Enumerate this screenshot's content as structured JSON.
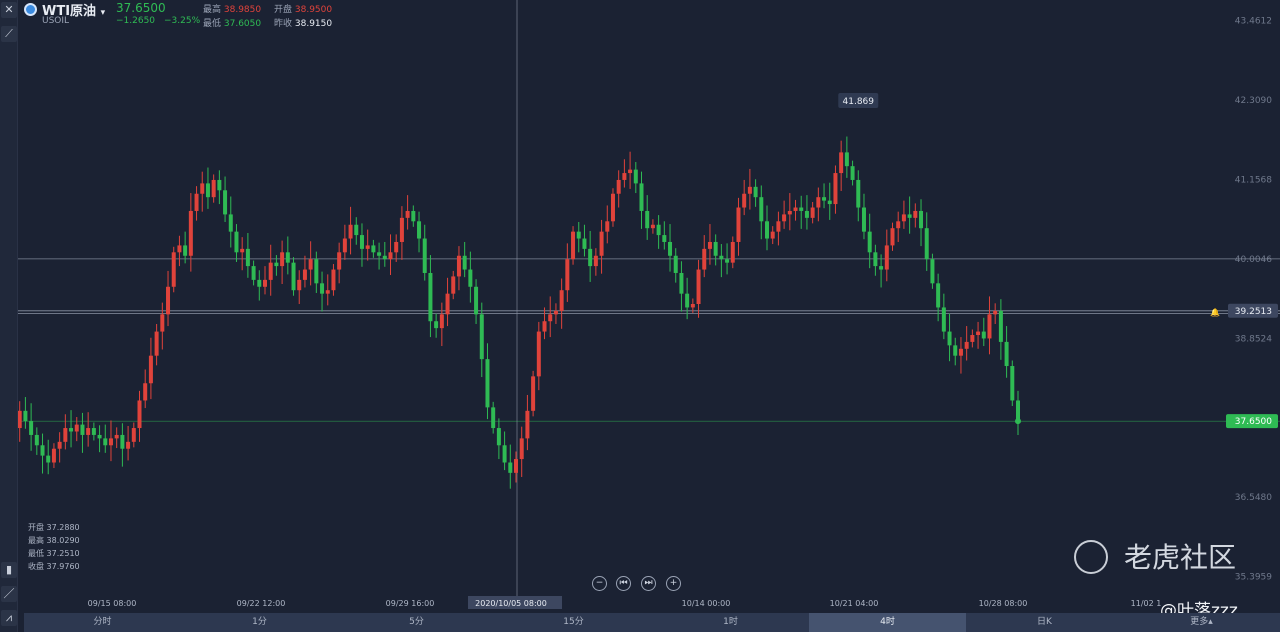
{
  "header": {
    "symbol_name": "WTI原油",
    "symbol_code": "USOIL",
    "last_price": "37.6500",
    "change": "−1.2650",
    "change_pct": "−3.25%",
    "high_label": "最高",
    "high_value": "38.9850",
    "low_label": "最低",
    "low_value": "37.6050",
    "open_label": "开盘",
    "open_value": "38.9500",
    "prev_label": "昨收",
    "prev_value": "38.9150"
  },
  "crosshair_ohlc": {
    "open": "开盘 37.2880",
    "high": "最高 38.0290",
    "low": "最低 37.2510",
    "close": "收盘 37.9760"
  },
  "chart_data": {
    "type": "candlestick",
    "y_ticks": [
      "43.4612",
      "42.3090",
      "41.1568",
      "40.0046",
      "38.8524",
      "36.5480",
      "35.3959"
    ],
    "ylim": [
      35.2,
      43.5
    ],
    "x_tick_labels": [
      "09/15 08:00",
      "09/22 12:00",
      "09/29 16:00",
      "2020/10/05 08:00",
      "10/14 00:00",
      "10/21 04:00",
      "10/28 08:00",
      "11/02 1"
    ],
    "crosshair_x_label": "2020/10/05 08:00",
    "price_label_right": "39.2513",
    "last_price_label": "37.6500",
    "max_label": "41.869",
    "horizontal_lines": [
      40.0046,
      39.2513,
      39.21,
      37.65
    ],
    "series": [
      {
        "name": "USOIL 4H",
        "closes": [
          37.55,
          37.8,
          37.65,
          37.45,
          37.3,
          37.15,
          37.05,
          37.25,
          37.35,
          37.55,
          37.5,
          37.6,
          37.45,
          37.55,
          37.45,
          37.4,
          37.3,
          37.4,
          37.45,
          37.25,
          37.35,
          37.55,
          37.95,
          38.2,
          38.6,
          38.95,
          39.2,
          39.6,
          40.1,
          40.2,
          40.05,
          40.7,
          40.95,
          41.1,
          40.9,
          41.15,
          41.0,
          40.65,
          40.4,
          40.1,
          40.15,
          39.9,
          39.7,
          39.6,
          39.7,
          39.95,
          39.9,
          40.1,
          39.95,
          39.55,
          39.7,
          39.85,
          40.0,
          39.65,
          39.5,
          39.55,
          39.85,
          40.1,
          40.3,
          40.5,
          40.35,
          40.15,
          40.2,
          40.1,
          40.05,
          40.0,
          40.1,
          40.25,
          40.6,
          40.7,
          40.55,
          40.3,
          39.8,
          39.1,
          39.0,
          39.2,
          39.5,
          39.75,
          40.05,
          39.85,
          39.6,
          39.2,
          38.55,
          37.85,
          37.55,
          37.3,
          37.05,
          36.9,
          37.1,
          37.4,
          37.8,
          38.3,
          38.95,
          39.1,
          39.2,
          39.25,
          39.55,
          40.0,
          40.4,
          40.3,
          40.15,
          39.9,
          40.05,
          40.4,
          40.55,
          40.95,
          41.15,
          41.25,
          41.3,
          41.1,
          40.7,
          40.45,
          40.5,
          40.35,
          40.25,
          40.05,
          39.8,
          39.5,
          39.3,
          39.35,
          39.85,
          40.15,
          40.25,
          40.05,
          40.0,
          39.95,
          40.25,
          40.75,
          40.95,
          41.05,
          40.9,
          40.55,
          40.3,
          40.4,
          40.55,
          40.65,
          40.7,
          40.75,
          40.7,
          40.6,
          40.75,
          40.9,
          40.85,
          40.8,
          41.25,
          41.55,
          41.35,
          41.15,
          40.75,
          40.4,
          40.1,
          39.9,
          39.85,
          40.2,
          40.45,
          40.55,
          40.65,
          40.6,
          40.7,
          40.45,
          40.0,
          39.65,
          39.3,
          38.95,
          38.75,
          38.6,
          38.7,
          38.8,
          38.9,
          38.95,
          38.85,
          39.2,
          39.25,
          38.8,
          38.45,
          37.95,
          37.65
        ]
      }
    ]
  },
  "zoom_controls": {
    "minus": "−",
    "first": "⏮",
    "last": "⏭",
    "plus": "+"
  },
  "timeframes": [
    "分时",
    "1分",
    "5分",
    "15分",
    "1时",
    "4时",
    "日K",
    "更多▴"
  ],
  "active_timeframe": "4时",
  "watermark": {
    "brand": "老虎社区",
    "user": "@叶落zzz"
  },
  "colors": {
    "up": "#e0433b",
    "down": "#2fbb54",
    "background": "#1b2233",
    "last_price": "#2fbb54"
  }
}
